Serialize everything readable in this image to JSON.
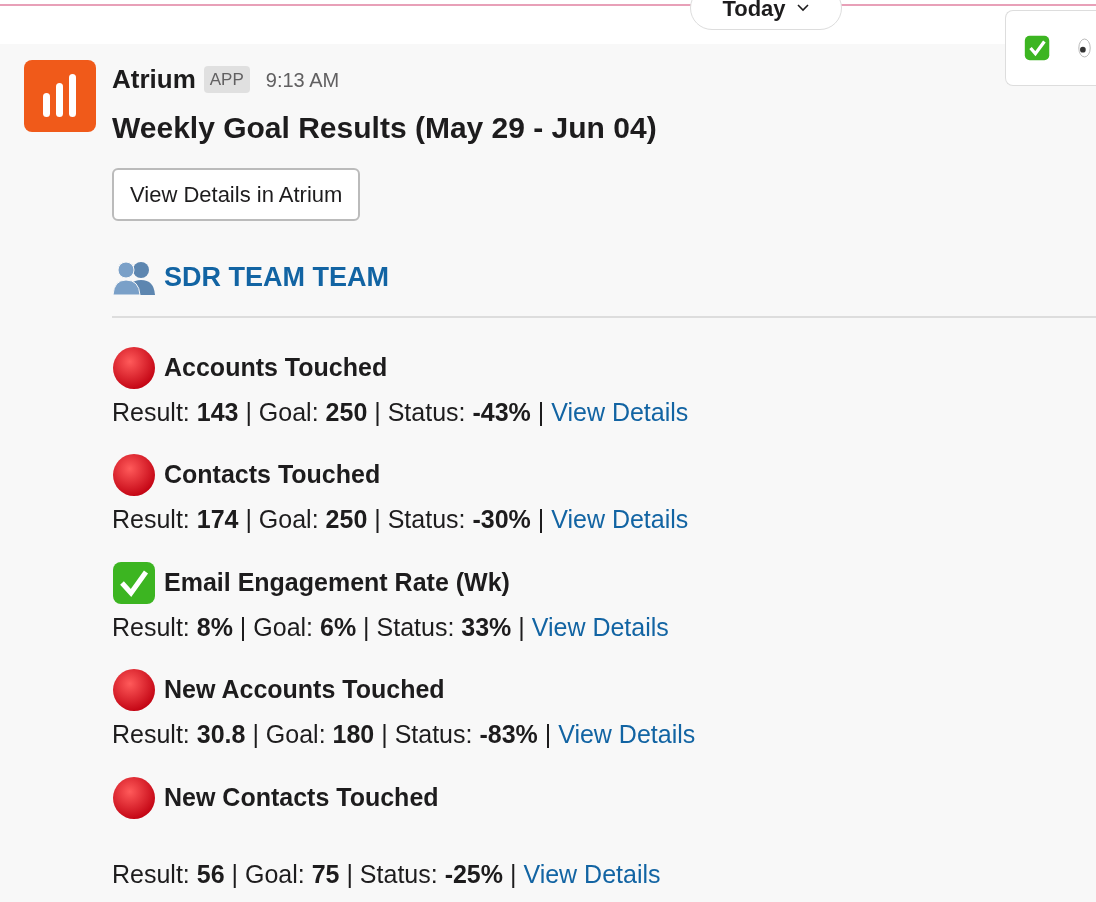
{
  "date_divider": {
    "label": "Today"
  },
  "message": {
    "sender": "Atrium",
    "badge": "APP",
    "time": "9:13 AM",
    "title": "Weekly Goal Results (May 29 - Jun 04)",
    "button": "View Details in Atrium",
    "team": "SDR TEAM TEAM",
    "goals": [
      {
        "kind": "missed",
        "name": "Accounts Touched",
        "summary": "Result: **143** | Goal: **250** | Status: **-43%** |",
        "link": "View Details"
      },
      {
        "kind": "missed",
        "name": "Contacts Touched",
        "summary": "Result: **174** | Goal: **250** | Status: **-30%** |",
        "link": "View Details"
      },
      {
        "kind": "met",
        "name": "Email Engagement Rate (Wk)",
        "summary": "Result: **8%** | Goal: **6%** | Status: **33%** |",
        "link": "View Details"
      },
      {
        "kind": "missed",
        "name": "New Accounts Touched",
        "summary": "Result: **30.8** | Goal: **180** | Status: **-83%** |",
        "link": "View Details"
      },
      {
        "kind": "missed",
        "name": "New Contacts Touched",
        "summary": "Result: **56** | Goal: **75** | Status: **-25%** |",
        "link": "View Details"
      }
    ]
  }
}
